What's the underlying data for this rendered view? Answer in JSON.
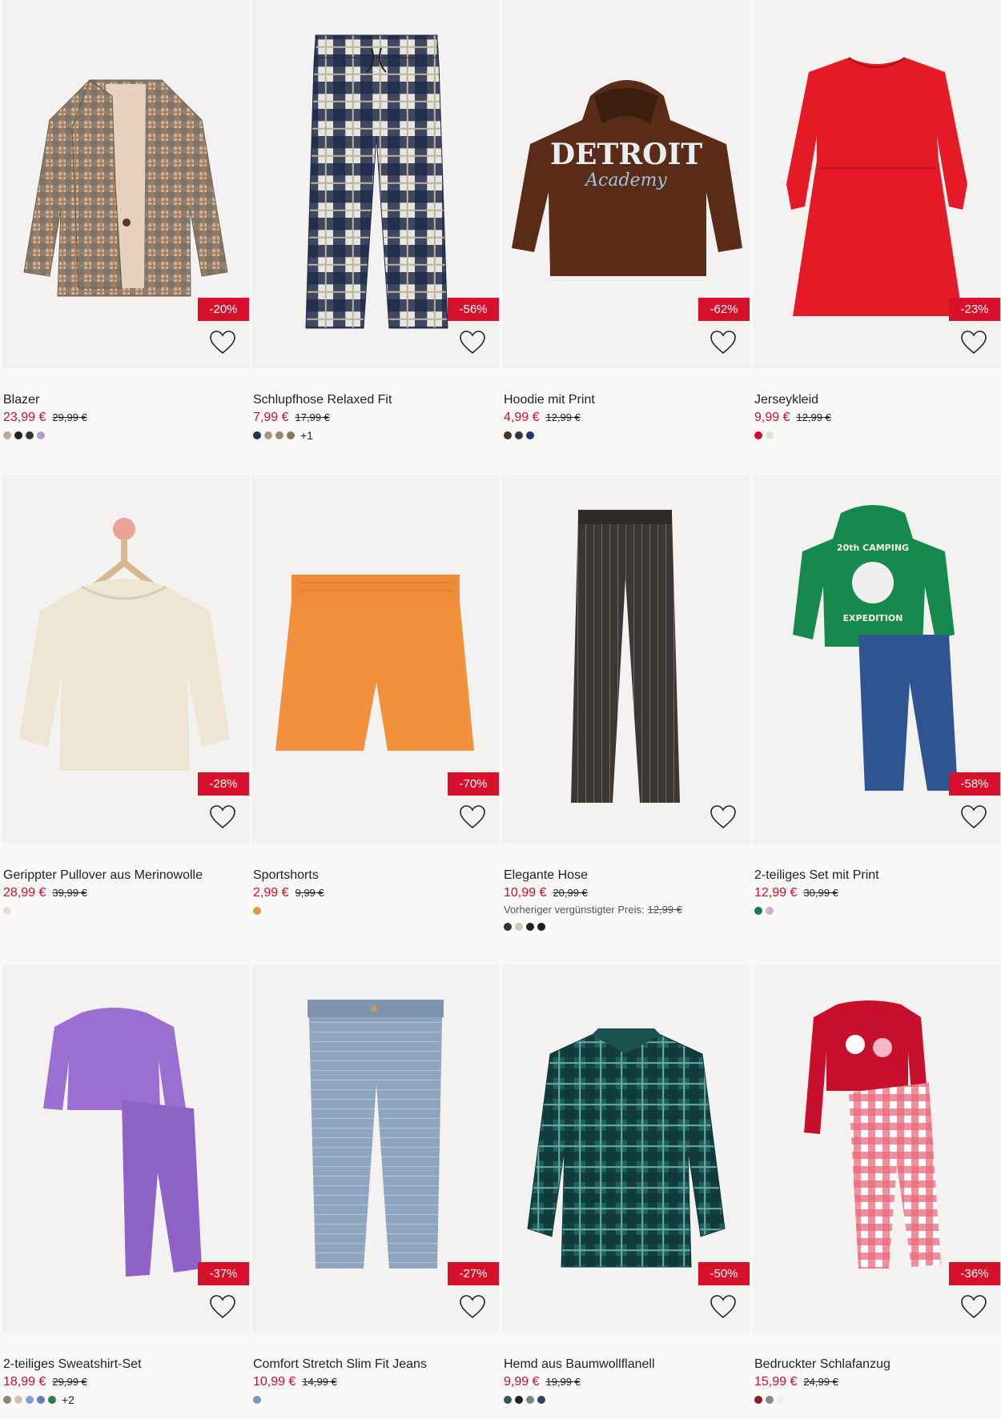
{
  "products": [
    {
      "name": "Blazer",
      "price": "23,99 €",
      "old_price": "29,99 €",
      "discount": "-20%",
      "swatches": [
        "#b8a995",
        "#222222",
        "#333333",
        "#b39ad1"
      ],
      "more": "",
      "prev_label": "",
      "prev_price": "",
      "art": "blazer"
    },
    {
      "name": "Schlupfhose Relaxed Fit",
      "price": "7,99 €",
      "old_price": "17,99 €",
      "discount": "-56%",
      "swatches": [
        "#28334f",
        "#a39a86",
        "#97896d",
        "#8a7a5a"
      ],
      "more": "+1",
      "prev_label": "",
      "prev_price": "",
      "art": "plaidpants"
    },
    {
      "name": "Hoodie mit Print",
      "price": "4,99 €",
      "old_price": "12,99 €",
      "discount": "-62%",
      "swatches": [
        "#4a3324",
        "#2d3546",
        "#1f3677"
      ],
      "more": "",
      "prev_label": "",
      "prev_price": "",
      "art": "hoodie"
    },
    {
      "name": "Jerseykleid",
      "price": "9,99 €",
      "old_price": "12,99 €",
      "discount": "-23%",
      "swatches": [
        "#c8102e",
        "#e8e3d3"
      ],
      "more": "",
      "prev_label": "",
      "prev_price": "",
      "art": "dress"
    },
    {
      "name": "Gerippter Pullover aus Merinowolle",
      "price": "28,99 €",
      "old_price": "39,99 €",
      "discount": "-28%",
      "swatches": [
        "#e5e1cf"
      ],
      "more": "",
      "prev_label": "",
      "prev_price": "",
      "art": "sweater"
    },
    {
      "name": "Sportshorts",
      "price": "2,99 €",
      "old_price": "9,99 €",
      "discount": "-70%",
      "swatches": [
        "#d4a13a"
      ],
      "more": "",
      "prev_label": "",
      "prev_price": "",
      "art": "shorts"
    },
    {
      "name": "Elegante Hose",
      "price": "10,99 €",
      "old_price": "20,99 €",
      "discount": "",
      "swatches": [
        "#333333",
        "#cfc6b6",
        "#222222",
        "#1e1e1e"
      ],
      "more": "",
      "prev_label": "Vorheriger vergünstigter Preis:",
      "prev_price": "12,99 €",
      "art": "trousers"
    },
    {
      "name": "2-teiliges Set mit Print",
      "price": "12,99 €",
      "old_price": "30,99 €",
      "discount": "-58%",
      "swatches": [
        "#1c7a4f",
        "#c9b2de"
      ],
      "more": "",
      "prev_label": "",
      "prev_price": "",
      "art": "set"
    },
    {
      "name": "2-teiliges Sweatshirt-Set",
      "price": "18,99 €",
      "old_price": "29,99 €",
      "discount": "-37%",
      "swatches": [
        "#8f8476",
        "#c8c3bb",
        "#7e9fd3",
        "#5c7fbf",
        "#2e7b4e"
      ],
      "more": "+2",
      "prev_label": "",
      "prev_price": "",
      "art": "purpleset"
    },
    {
      "name": "Comfort Stretch Slim Fit Jeans",
      "price": "10,99 €",
      "old_price": "14,99 €",
      "discount": "-27%",
      "swatches": [
        "#8097b8"
      ],
      "more": "",
      "prev_label": "",
      "prev_price": "",
      "art": "jeans"
    },
    {
      "name": "Hemd aus Baumwollflanell",
      "price": "9,99 €",
      "old_price": "19,99 €",
      "discount": "-50%",
      "swatches": [
        "#2b5b58",
        "#222222",
        "#6e8a8a",
        "#2c4363"
      ],
      "more": "",
      "prev_label": "",
      "prev_price": "",
      "art": "flannel"
    },
    {
      "name": "Bedruckter Schlafanzug",
      "price": "15,99 €",
      "old_price": "24,99 €",
      "discount": "-36%",
      "swatches": [
        "#8b1d2c",
        "#888888",
        "#eeeeee"
      ],
      "more": "",
      "prev_label": "",
      "prev_price": "",
      "art": "pajama"
    }
  ],
  "colors": {
    "sale": "#c8102e",
    "badge": "#d7112b",
    "card_bg": "#f3f2f0",
    "page_bg": "#faf9f8"
  },
  "icons": {
    "favorite": "heart-outline-icon"
  }
}
